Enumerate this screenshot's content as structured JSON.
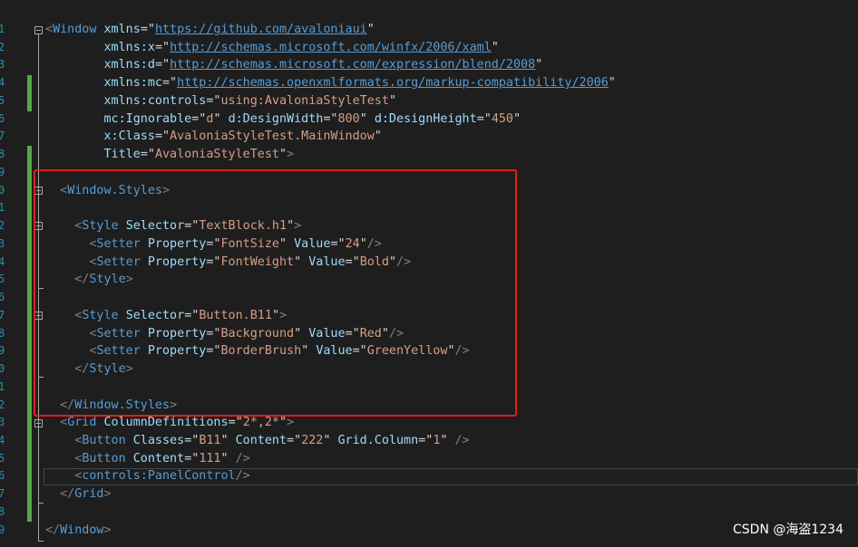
{
  "line_numbers": [
    "1",
    "2",
    "3",
    "4",
    "5",
    "6",
    "7",
    "8",
    "9",
    "0",
    "1",
    "2",
    "3",
    "4",
    "5",
    "6",
    "7",
    "8",
    "9",
    "0",
    "1",
    "2",
    "3",
    "4",
    "5",
    "6",
    "7",
    "8",
    "9"
  ],
  "code": {
    "l1": {
      "open": "<",
      "tag": "Window",
      "attr": "xmlns",
      "eq": "=\"",
      "url": "https://github.com/avaloniaui",
      "close": "\""
    },
    "l2": {
      "attr": "xmlns:x",
      "eq": "=\"",
      "url": "http://schemas.microsoft.com/winfx/2006/xaml",
      "close": "\""
    },
    "l3": {
      "attr": "xmlns:d",
      "eq": "=\"",
      "url": "http://schemas.microsoft.com/expression/blend/2008",
      "close": "\""
    },
    "l4": {
      "attr": "xmlns:mc",
      "eq": "=\"",
      "url": "http://schemas.openxmlformats.org/markup-compatibility/2006",
      "close": "\""
    },
    "l5": {
      "attr": "xmlns:controls",
      "eq": "=\"",
      "val": "using:AvaloniaStyleTest",
      "close": "\""
    },
    "l6": {
      "attr1": "mc:Ignorable",
      "val1": "d",
      "attr2": "d:DesignWidth",
      "val2": "800",
      "attr3": "d:DesignHeight",
      "val3": "450"
    },
    "l7": {
      "attr": "x:Class",
      "val": "AvaloniaStyleTest.MainWindow"
    },
    "l8": {
      "attr": "Title",
      "val": "AvaloniaStyleTest"
    },
    "l10": {
      "tag": "Window.Styles"
    },
    "l12": {
      "tag": "Style",
      "attr": "Selector",
      "val": "TextBlock.h1"
    },
    "l13": {
      "tag": "Setter",
      "attr1": "Property",
      "val1": "FontSize",
      "attr2": "Value",
      "val2": "24"
    },
    "l14": {
      "tag": "Setter",
      "attr1": "Property",
      "val1": "FontWeight",
      "attr2": "Value",
      "val2": "Bold"
    },
    "l15": {
      "tag": "Style"
    },
    "l17": {
      "tag": "Style",
      "attr": "Selector",
      "val": "Button.B11"
    },
    "l18": {
      "tag": "Setter",
      "attr1": "Property",
      "val1": "Background",
      "attr2": "Value",
      "val2": "Red"
    },
    "l19": {
      "tag": "Setter",
      "attr1": "Property",
      "val1": "BorderBrush",
      "attr2": "Value",
      "val2": "GreenYellow"
    },
    "l20": {
      "tag": "Style"
    },
    "l22": {
      "tag": "Window.Styles"
    },
    "l23": {
      "tag": "Grid",
      "attr": "ColumnDefinitions",
      "val": "2*,2*"
    },
    "l24": {
      "tag": "Button",
      "attr1": "Classes",
      "val1": "B11",
      "attr2": "Content",
      "val2": "222",
      "attr3": "Grid.Column",
      "val3": "1"
    },
    "l25": {
      "tag": "Button",
      "attr": "Content",
      "val": "111"
    },
    "l26": {
      "tag": "controls:PanelControl"
    },
    "l27": {
      "tag": "Grid"
    },
    "l29": {
      "tag": "Window"
    }
  },
  "colors": {
    "tag": "#569cd6",
    "attribute": "#9cdcfe",
    "string": "#d69d85",
    "punctuation": "#808080",
    "line_number": "#2b91af",
    "change_marker": "#57a64a",
    "highlight_box": "#e51c1c"
  },
  "watermark": "CSDN @海盗1234"
}
